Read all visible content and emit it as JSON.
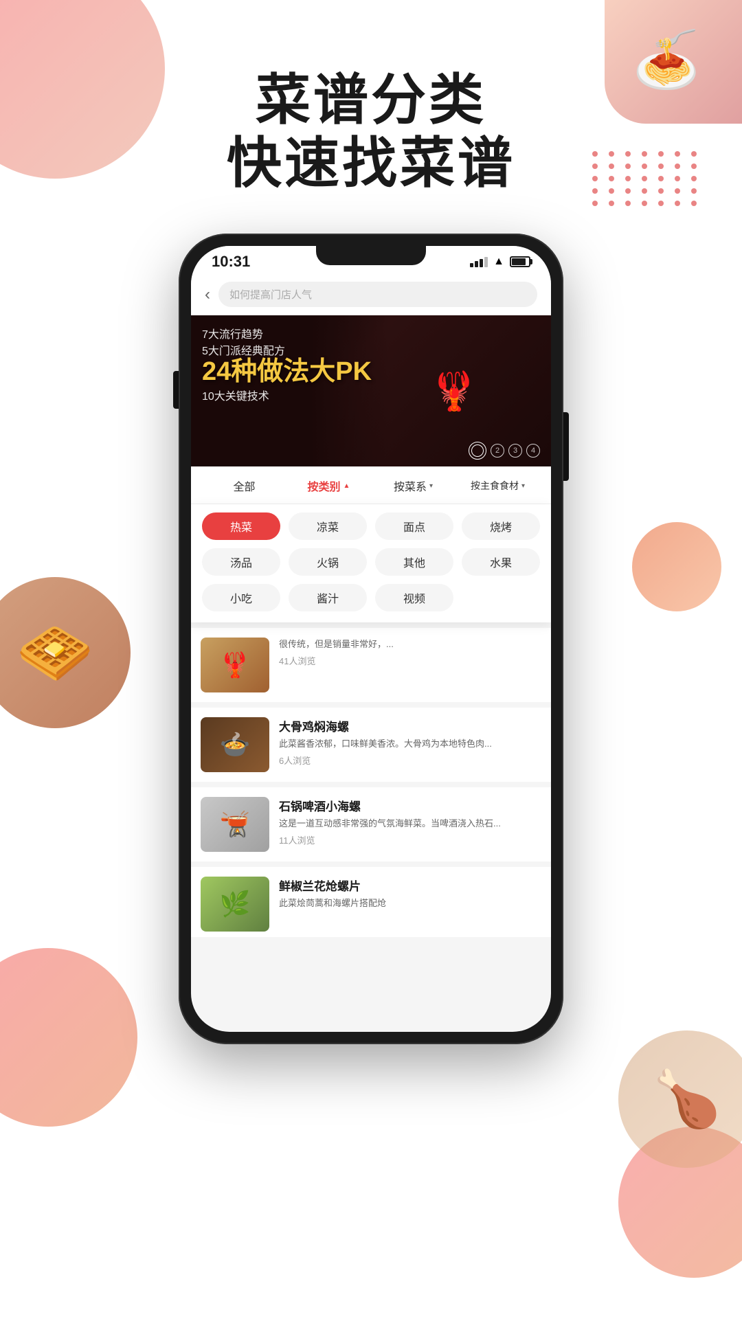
{
  "page": {
    "title1": "菜谱分类",
    "title2": "快速找菜谱"
  },
  "phone": {
    "status": {
      "time": "10:31"
    },
    "search": {
      "placeholder": "如何提高门店人气"
    },
    "banner": {
      "line1": "7大流行趋势",
      "line2": "5大门派经典配方",
      "big_text": "24种做法大PK",
      "line4": "10大关键技术",
      "dots": [
        "2",
        "3",
        "4"
      ]
    },
    "filter_tabs": [
      {
        "label": "全部",
        "active": false
      },
      {
        "label": "按类别",
        "active": true,
        "arrow": "▲"
      },
      {
        "label": "按菜系",
        "active": false,
        "arrow": "▼"
      },
      {
        "label": "按主食食材",
        "active": false,
        "arrow": "▼"
      }
    ],
    "categories": [
      {
        "label": "热菜",
        "active": true
      },
      {
        "label": "凉菜",
        "active": false
      },
      {
        "label": "面点",
        "active": false
      },
      {
        "label": "烧烤",
        "active": false
      },
      {
        "label": "汤品",
        "active": false
      },
      {
        "label": "火锅",
        "active": false
      },
      {
        "label": "其他",
        "active": false
      },
      {
        "label": "水果",
        "active": false
      },
      {
        "label": "小吃",
        "active": false
      },
      {
        "label": "酱汁",
        "active": false
      },
      {
        "label": "视频",
        "active": false
      }
    ],
    "recipes": [
      {
        "title": "",
        "desc": "很传统，但是销量非常好，...",
        "views": "41人浏览",
        "emoji": "🦞"
      },
      {
        "title": "大骨鸡焖海螺",
        "desc": "此菜酱香浓郁，口味鲜美香浓。大骨鸡为本地特色肉...",
        "views": "6人浏览",
        "emoji": "🍲"
      },
      {
        "title": "石锅啤酒小海螺",
        "desc": "这是一道互动感非常强的气氛海鲜菜。当啤酒浇入热石...",
        "views": "11人浏览",
        "emoji": "🍺"
      },
      {
        "title": "鲜椒兰花炝螺片",
        "desc": "此菜烩茼蒿和海螺片搭配炝",
        "views": "",
        "emoji": "🌶️"
      }
    ]
  }
}
